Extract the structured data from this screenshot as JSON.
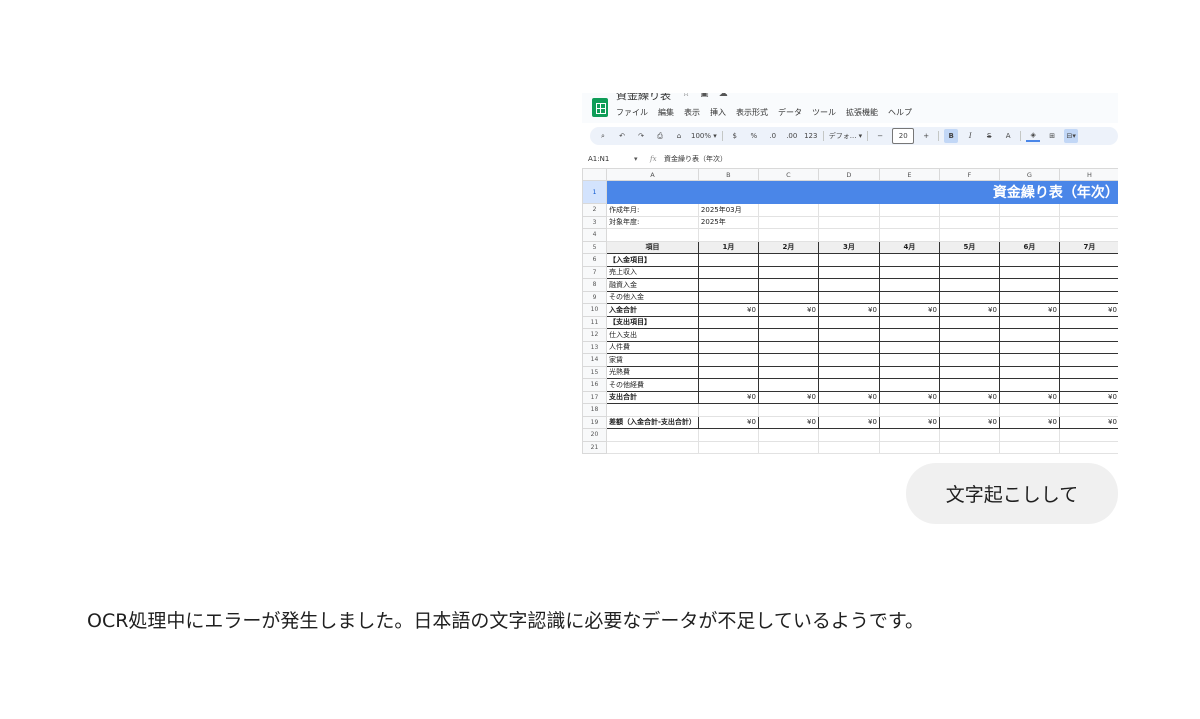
{
  "sheet": {
    "doc_title": "資金繰り表",
    "title_icons": [
      "star-icon",
      "folder-icon",
      "cloud-icon"
    ],
    "menu": [
      "ファイル",
      "編集",
      "表示",
      "挿入",
      "表示形式",
      "データ",
      "ツール",
      "拡張機能",
      "ヘルプ"
    ],
    "toolbar": {
      "search": "search-icon",
      "undo": "undo-icon",
      "redo": "redo-icon",
      "print": "print-icon",
      "paint": "paint-format-icon",
      "zoom": "100%",
      "currency": "$",
      "percent": "%",
      "dec_minus": ".0",
      "dec_plus": ".00",
      "format123": "123",
      "font": "デフォ...",
      "minus": "−",
      "font_size": "20",
      "plus": "+",
      "bold": "B",
      "italic": "I",
      "strike": "S",
      "text_color": "A"
    },
    "name_box": "A1:N1",
    "fx_label": "fx",
    "formula": "資金繰り表（年次）",
    "columns": [
      "A",
      "B",
      "C",
      "D",
      "E",
      "F",
      "G",
      "H"
    ],
    "row_numbers": [
      "1",
      "2",
      "3",
      "4",
      "5",
      "6",
      "7",
      "8",
      "9",
      "10",
      "11",
      "12",
      "13",
      "14",
      "15",
      "16",
      "17",
      "18",
      "19",
      "20",
      "21"
    ],
    "title_cell": "資金繰り表（年次）",
    "row2": {
      "label": "作成年月:",
      "value": "2025年03月"
    },
    "row3": {
      "label": "対象年度:",
      "value": "2025年"
    },
    "header": [
      "項目",
      "1月",
      "2月",
      "3月",
      "4月",
      "5月",
      "6月",
      "7月"
    ],
    "items": [
      "【入金項目】",
      "売上収入",
      "融資入金",
      "その他入金",
      "入金合計",
      "【支出項目】",
      "仕入支出",
      "人件費",
      "家賃",
      "光熱費",
      "その他経費",
      "支出合計",
      "",
      "差額（入金合計-支出合計）"
    ],
    "zero": "¥0"
  },
  "chat": {
    "user_message": "文字起こしして",
    "assistant_message": "OCR処理中にエラーが発生しました。日本語の文字認識に必要なデータが不足しているようです。"
  },
  "colors": {
    "title_fill": "#4a86e8",
    "sheets_green": "#0f9d58",
    "bubble": "#f0f0f0"
  }
}
